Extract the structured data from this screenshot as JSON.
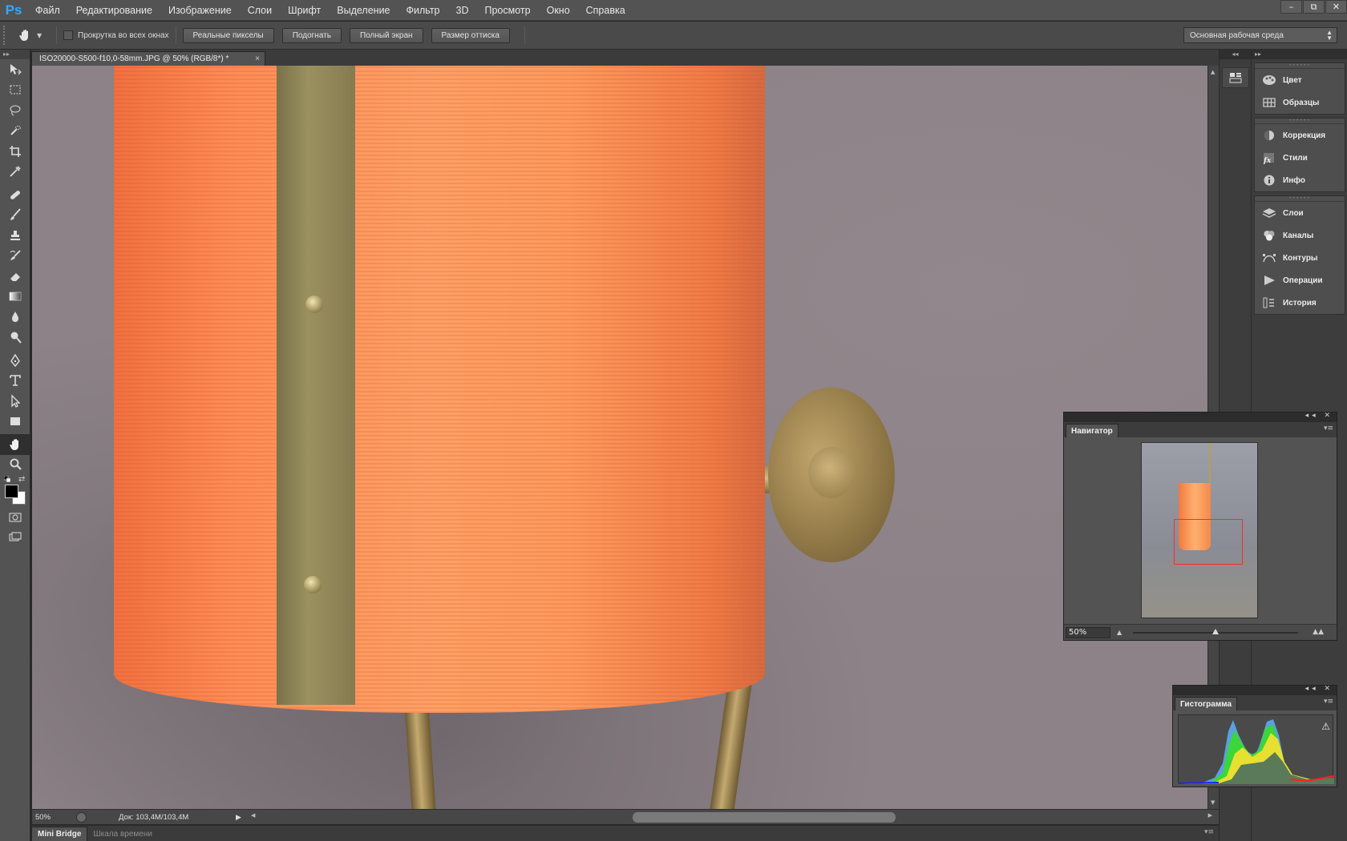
{
  "app": {
    "logo": "Ps"
  },
  "menu": [
    "Файл",
    "Редактирование",
    "Изображение",
    "Слои",
    "Шрифт",
    "Выделение",
    "Фильтр",
    "3D",
    "Просмотр",
    "Окно",
    "Справка"
  ],
  "window_controls": [
    "–",
    "⧉",
    "✕"
  ],
  "options": {
    "scroll_all_windows": "Прокрутка во всех окнах",
    "buttons": [
      "Реальные пикселы",
      "Подогнать",
      "Полный экран",
      "Размер оттиска"
    ],
    "workspace": "Основная рабочая среда"
  },
  "document": {
    "tab_title": "ISO20000-S500-f10,0-58mm.JPG @ 50% (RGB/8*) *",
    "close_glyph": "×"
  },
  "status": {
    "zoom": "50%",
    "doc_size": "Док: 103,4M/103,4M",
    "play_glyph": "▶"
  },
  "bottom_tabs": [
    "Mini Bridge",
    "Шкала времени"
  ],
  "dock": {
    "groups": [
      [
        "Цвет",
        "Образцы"
      ],
      [
        "Коррекция",
        "Стили",
        "Инфо"
      ],
      [
        "Слои",
        "Каналы",
        "Контуры",
        "Операции",
        "История"
      ]
    ]
  },
  "navigator": {
    "title": "Навигатор",
    "zoom": "50%",
    "zoom_fraction": 0.5
  },
  "histogram": {
    "title": "Гистограмма",
    "warning": "⚠"
  },
  "colors": {
    "foreground": "#000000",
    "background": "#ffffff",
    "accent": "#31a8ff",
    "nav_view_box": "#ff2a2a"
  }
}
